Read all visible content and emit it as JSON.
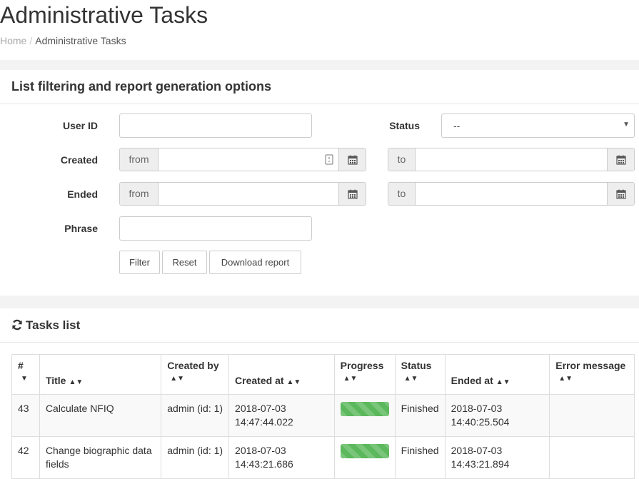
{
  "page": {
    "title": "Administrative Tasks",
    "breadcrumb": {
      "home": "Home",
      "separator": "/",
      "current": "Administrative Tasks"
    }
  },
  "filters": {
    "title": "List filtering and report generation options",
    "user_id_label": "User ID",
    "user_id_value": "",
    "status_label": "Status",
    "status_selected": "--",
    "created_label": "Created",
    "ended_label": "Ended",
    "from_label": "from",
    "to_label": "to",
    "phrase_label": "Phrase",
    "phrase_value": "",
    "buttons": {
      "filter": "Filter",
      "reset": "Reset",
      "download": "Download report"
    }
  },
  "tasks": {
    "title": "Tasks list",
    "columns": {
      "id": "#",
      "title": "Title",
      "created_by": "Created by",
      "created_at": "Created at",
      "progress": "Progress",
      "status": "Status",
      "ended_at": "Ended at",
      "error": "Error message"
    },
    "rows": [
      {
        "id": "43",
        "title": "Calculate NFIQ",
        "created_by": "admin (id: 1)",
        "created_date": "2018-07-03",
        "created_time": "14:47:44.022",
        "progress": 100,
        "status": "Finished",
        "ended_date": "2018-07-03",
        "ended_time": "14:40:25.504",
        "error": ""
      },
      {
        "id": "42",
        "title": "Change biographic data fields",
        "created_by": "admin (id: 1)",
        "created_date": "2018-07-03",
        "created_time": "14:43:21.686",
        "progress": 100,
        "status": "Finished",
        "ended_date": "2018-07-03",
        "ended_time": "14:43:21.894",
        "error": ""
      }
    ]
  },
  "colors": {
    "progress": "#5cb85c",
    "band": "#f3f3f3"
  }
}
